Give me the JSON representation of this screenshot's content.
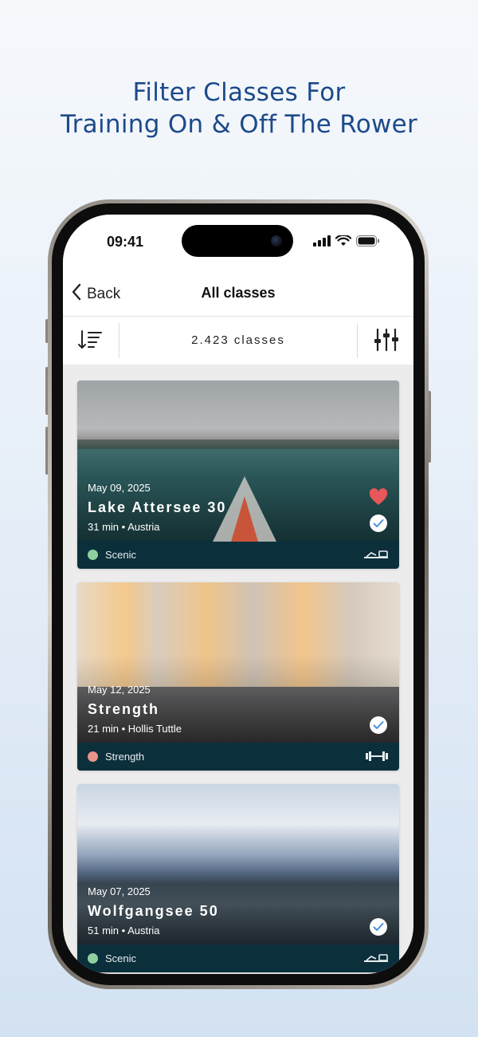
{
  "headline": {
    "line1": "Filter Classes For",
    "line2": "Training On & Off The Rower"
  },
  "status_bar": {
    "time": "09:41"
  },
  "nav": {
    "back_label": "Back",
    "title": "All classes"
  },
  "toolbar": {
    "count_label": "2.423 classes"
  },
  "classes": [
    {
      "date": "May 09, 2025",
      "title": "Lake Attersee 30",
      "meta": "31 min • Austria",
      "category": "Scenic",
      "category_color": "#8fd19e",
      "favorited": true,
      "completed": true,
      "type_icon": "rower-icon"
    },
    {
      "date": "May 12, 2025",
      "title": "Strength",
      "meta": "21 min • Hollis Tuttle",
      "category": "Strength",
      "category_color": "#e8958a",
      "favorited": false,
      "completed": true,
      "type_icon": "dumbbell-icon"
    },
    {
      "date": "May 07, 2025",
      "title": "Wolfgangsee 50",
      "meta": "51 min • Austria",
      "category": "Scenic",
      "category_color": "#8fd19e",
      "favorited": false,
      "completed": true,
      "type_icon": "rower-icon"
    }
  ],
  "colors": {
    "headline": "#1d4a8a",
    "card_footer": "#0c2f3c",
    "heart": "#e8575a",
    "check": "#4a90d9"
  }
}
